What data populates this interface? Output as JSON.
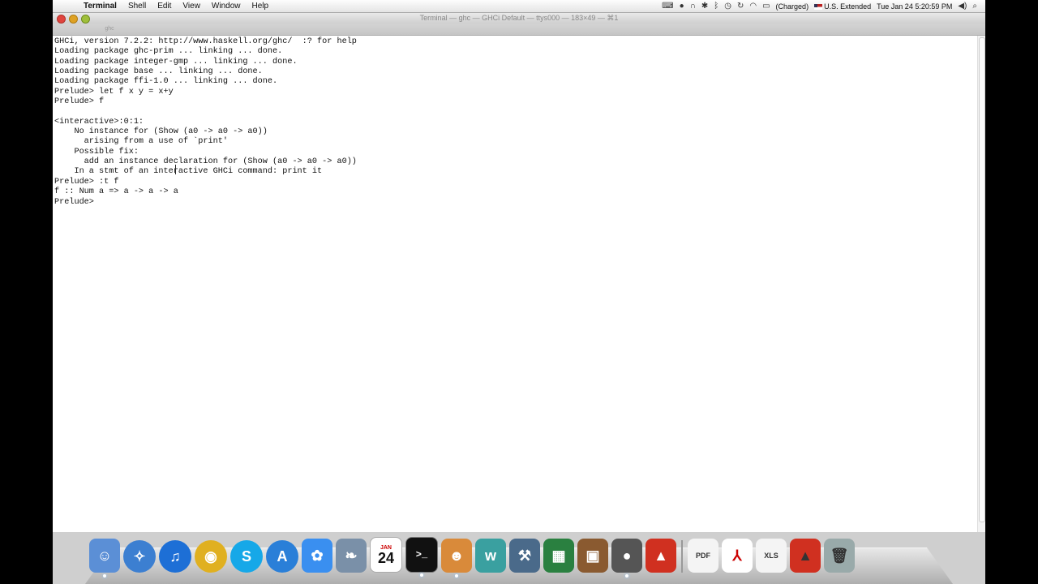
{
  "menubar": {
    "app": "Terminal",
    "menus": [
      "Shell",
      "Edit",
      "View",
      "Window",
      "Help"
    ],
    "status": {
      "battery": "(Charged)",
      "input_source": "U.S. Extended",
      "clock": "Tue Jan 24  5:20:59 PM"
    }
  },
  "window": {
    "title": "Terminal — ghc — GHCi Default — ttys000 — 183×49 — ⌘1",
    "tab_label": "ghc"
  },
  "terminal": {
    "lines": [
      "GHCi, version 7.2.2: http://www.haskell.org/ghc/  :? for help",
      "Loading package ghc-prim ... linking ... done.",
      "Loading package integer-gmp ... linking ... done.",
      "Loading package base ... linking ... done.",
      "Loading package ffi-1.0 ... linking ... done.",
      "Prelude> let f x y = x+y",
      "Prelude> f",
      "",
      "<interactive>:0:1:",
      "    No instance for (Show (a0 -> a0 -> a0))",
      "      arising from a use of `print'",
      "    Possible fix:",
      "      add an instance declaration for (Show (a0 -> a0 -> a0))",
      "    In a stmt of an interactive GHCi command: print it",
      "Prelude> :t f",
      "f :: Num a => a -> a -> a",
      "Prelude> "
    ]
  },
  "dock": {
    "calendar_day": "24",
    "calendar_month": "JAN",
    "pdf_label": "PDF",
    "xls_label": "XLS",
    "apps": [
      {
        "name": "finder-icon",
        "color": "#5b8fd6"
      },
      {
        "name": "safari-icon",
        "color": "#3c7fd1"
      },
      {
        "name": "itunes-icon",
        "color": "#1d6fd6"
      },
      {
        "name": "chrome-icon",
        "color": "#e0b020"
      },
      {
        "name": "skype-icon",
        "color": "#16a8e8"
      },
      {
        "name": "app-store-icon",
        "color": "#2a7fd8"
      },
      {
        "name": "network-icon",
        "color": "#3a8ff0"
      },
      {
        "name": "preview-icon",
        "color": "#7a90a8"
      },
      {
        "name": "calendar-icon",
        "color": "#ffffff"
      },
      {
        "name": "terminal-icon",
        "color": "#111111"
      },
      {
        "name": "cyberduck-icon",
        "color": "#d98a3a"
      },
      {
        "name": "wunderlist-icon",
        "color": "#3aa0a0"
      },
      {
        "name": "xcode-icon",
        "color": "#4a6a8a"
      },
      {
        "name": "activity-monitor-icon",
        "color": "#2a8040"
      },
      {
        "name": "keynote-icon",
        "color": "#8a5a30"
      },
      {
        "name": "screen-recorder-icon",
        "color": "#555555"
      },
      {
        "name": "presentation-icon",
        "color": "#d03020"
      }
    ]
  }
}
